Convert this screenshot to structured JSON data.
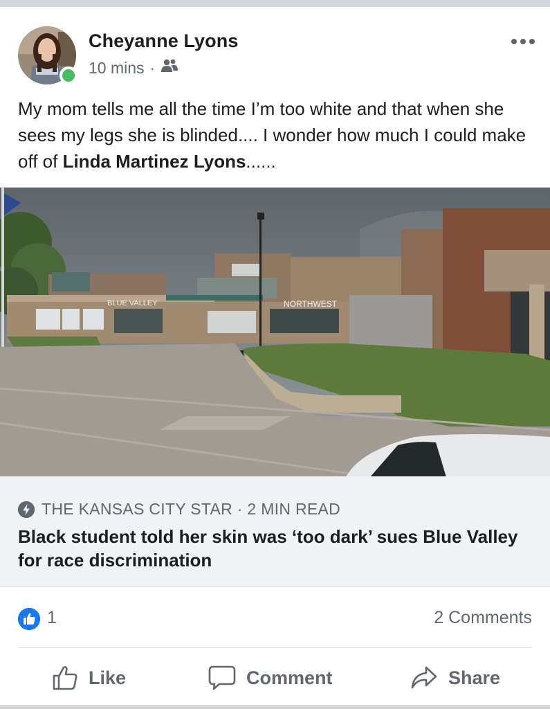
{
  "post": {
    "author": "Cheyanne Lyons",
    "time": "10 mins",
    "separator": "·",
    "audience_icon": "friends-icon",
    "text_before": "My mom tells me all the time I’m too white and that when she sees my legs she is blinded.... I wonder how much I could make off of ",
    "tagged_name": "Linda Martinez Lyons",
    "text_after": "......"
  },
  "link": {
    "building_sign_1": "BLUE VALLEY",
    "building_sign_2": "NORTHWEST",
    "source": "THE KANSAS CITY STAR · 2 MIN READ",
    "source_icon": "lightning-bolt-icon",
    "headline": "Black student told her skin was ‘too dark’ sues Blue Valley for race discrimination"
  },
  "reactions": {
    "like_count": "1",
    "comments": "2 Comments"
  },
  "actions": {
    "like": "Like",
    "comment": "Comment",
    "share": "Share"
  },
  "colors": {
    "like_blue": "#1877f2",
    "online_green": "#45bd62",
    "secondary_text": "#606770",
    "preview_bg": "#f0f2f5"
  }
}
